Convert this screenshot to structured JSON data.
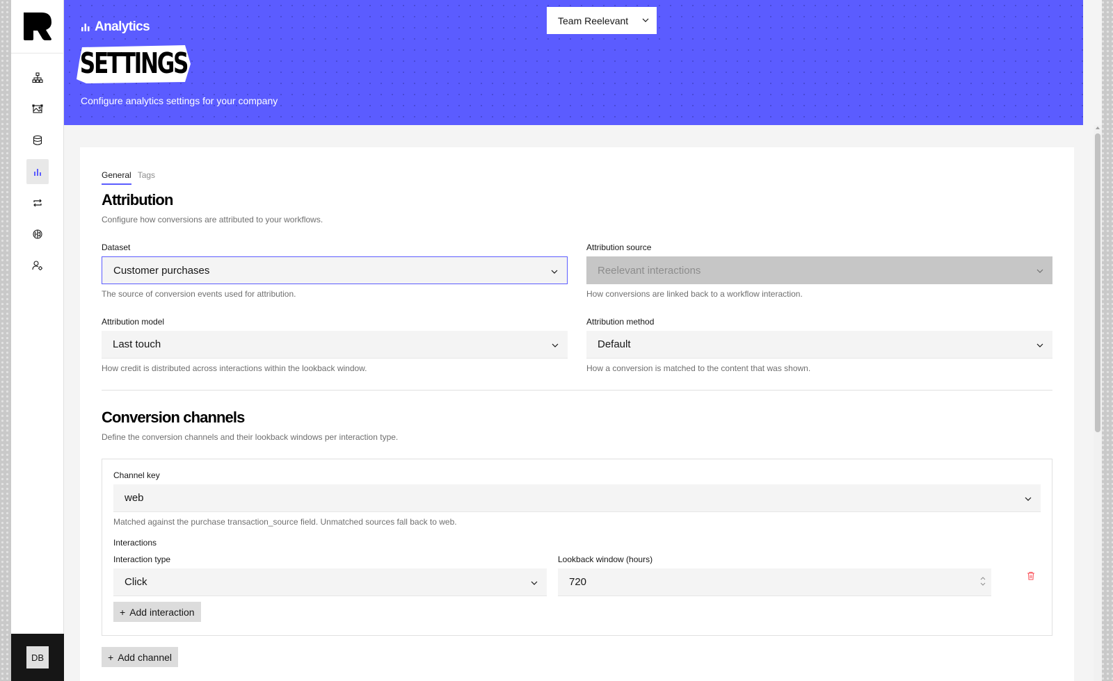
{
  "colors": {
    "brand": "#5b5cff",
    "danger": "#fa4d56",
    "sidebar_footer": "#161616"
  },
  "sidebar": {
    "logo_icon": "reelevant-logo",
    "items": [
      {
        "icon": "workflow-icon",
        "label": "Workflows"
      },
      {
        "icon": "content-icon",
        "label": "Content"
      },
      {
        "icon": "database-icon",
        "label": "Data"
      },
      {
        "icon": "analytics-icon",
        "label": "Analytics",
        "active": true
      },
      {
        "icon": "sync-icon",
        "label": "Sync"
      },
      {
        "icon": "brain-icon",
        "label": "AI"
      },
      {
        "icon": "user-settings-icon",
        "label": "Users"
      }
    ],
    "avatar_initials": "DB"
  },
  "header": {
    "breadcrumb": "Analytics",
    "title": "SETTINGS",
    "subtitle": "Configure analytics settings for your company",
    "team_selector": "Team Reelevant"
  },
  "tabs": [
    {
      "label": "General",
      "active": true
    },
    {
      "label": "Tags",
      "active": false
    }
  ],
  "attribution": {
    "title": "Attribution",
    "description": "Configure how conversions are attributed to your workflows.",
    "dataset": {
      "label": "Dataset",
      "value": "Customer purchases",
      "helper": "The source of conversion events used for attribution."
    },
    "source": {
      "label": "Attribution source",
      "value": "Reelevant interactions",
      "helper": "How conversions are linked back to a workflow interaction."
    },
    "model": {
      "label": "Attribution model",
      "value": "Last touch",
      "helper": "How credit is distributed across interactions within the lookback window."
    },
    "method": {
      "label": "Attribution method",
      "value": "Default",
      "helper": "How a conversion is matched to the content that was shown."
    }
  },
  "channels": {
    "title": "Conversion channels",
    "description": "Define the conversion channels and their lookback windows per interaction type.",
    "channel_key": {
      "label": "Channel key",
      "value": "web",
      "helper": "Matched against the purchase transaction_source field. Unmatched sources fall back to web."
    },
    "interactions_heading": "Interactions",
    "interaction_type_label": "Interaction type",
    "interaction_type_value": "Click",
    "lookback_label": "Lookback window (hours)",
    "lookback_value": "720",
    "add_interaction": "Add interaction",
    "add_channel": "Add channel"
  }
}
